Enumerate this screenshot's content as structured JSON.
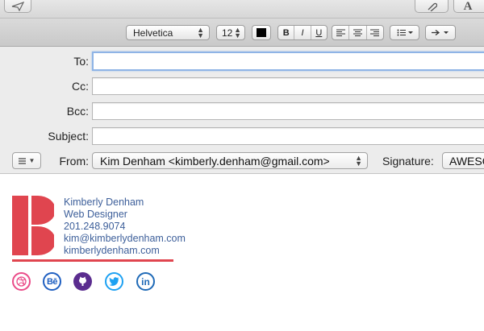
{
  "toolbar": {
    "send_icon": "paper-plane-icon",
    "attach_icon": "paperclip-icon",
    "fonts_button_label": "A"
  },
  "format_bar": {
    "font_family": "Helvetica",
    "font_size": "12",
    "text_color": "#000000",
    "bold_label": "B",
    "italic_label": "I",
    "underline_label": "U",
    "align_left_icon": "align-left-icon",
    "align_center_icon": "align-center-icon",
    "align_right_icon": "align-right-icon",
    "list_icon": "bullet-list-icon",
    "indent_icon": "indent-arrow-icon"
  },
  "header": {
    "to_label": "To:",
    "to_value": "",
    "cc_label": "Cc:",
    "cc_value": "",
    "bcc_label": "Bcc:",
    "bcc_value": "",
    "subject_label": "Subject:",
    "subject_value": "",
    "from_label": "From:",
    "from_value": "Kim Denham <kimberly.denham@gmail.com>",
    "signature_label": "Signature:",
    "signature_value": "AWESOME"
  },
  "signature": {
    "name": "Kimberly Denham",
    "role": "Web Designer",
    "phone": "201.248.9074",
    "email": "kim@kimberlydenham.com",
    "website": "kimberlydenham.com",
    "logo_letter": "K",
    "colors": {
      "brand_red": "#e0454f",
      "text_blue": "#3d5f9a",
      "dribbble": "#ea4c89",
      "behance": "#1f5fc1",
      "github": "#5b2d8f",
      "twitter": "#1da1f2",
      "linkedin": "#1f6ab7"
    },
    "social": [
      {
        "icon": "dribbble-icon",
        "text": ""
      },
      {
        "icon": "behance-icon",
        "text": "Bē"
      },
      {
        "icon": "github-icon",
        "text": ""
      },
      {
        "icon": "twitter-icon",
        "text": ""
      },
      {
        "icon": "linkedin-icon",
        "text": "in"
      }
    ]
  }
}
